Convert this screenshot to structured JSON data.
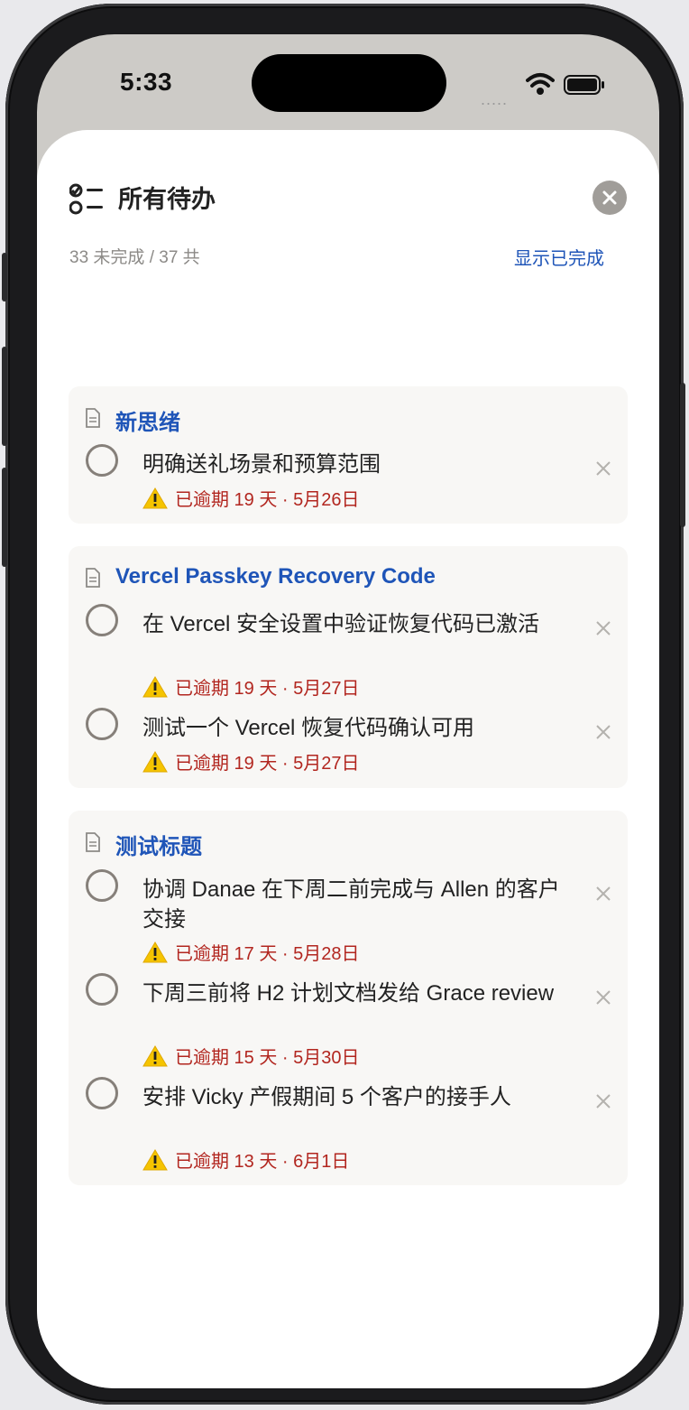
{
  "status": {
    "time": "5:33",
    "signal": "....."
  },
  "header": {
    "title": "所有待办"
  },
  "summary": {
    "text": "33 未完成 / 37 共",
    "show_completed": "显示已完成"
  },
  "groups": [
    {
      "title": "新思绪",
      "tasks": [
        {
          "text": "明确送礼场景和预算范围",
          "due": "已逾期 19 天 · 5月26日"
        }
      ]
    },
    {
      "title": "Vercel Passkey Recovery Code",
      "tasks": [
        {
          "text": "在 Vercel 安全设置中验证恢复代码已激活",
          "due": "已逾期 19 天 · 5月27日"
        },
        {
          "text": "测试一个 Vercel 恢复代码确认可用",
          "due": "已逾期 19 天 · 5月27日"
        }
      ]
    },
    {
      "title": "测试标题",
      "tasks": [
        {
          "text": "协调 Danae 在下周二前完成与 Allen 的客户交接",
          "due": "已逾期 17 天 · 5月28日"
        },
        {
          "text": "下周三前将 H2 计划文档发给 Grace review",
          "due": "已逾期 15 天 · 5月30日"
        },
        {
          "text": "安排 Vicky 产假期间 5 个客户的接手人",
          "due": "已逾期 13 天 · 6月1日"
        }
      ]
    }
  ],
  "colors": {
    "accent": "#1f55b8",
    "overdue": "#b2261f",
    "card_bg": "#f8f7f5"
  },
  "icons": {
    "header": "checklist-icon",
    "close": "close-circle-icon",
    "group": "document-icon",
    "warning": "warning-icon",
    "remove": "x-icon",
    "checkbox": "circle-checkbox-icon"
  }
}
